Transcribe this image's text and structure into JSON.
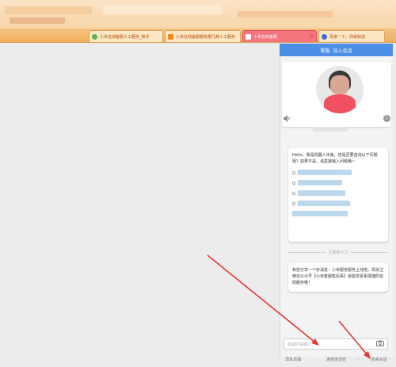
{
  "tabs": [
    {
      "title": "小米在线客服人工服务_知乎",
      "favicon_color": "#56b84a",
      "active": false
    },
    {
      "title": "小米在线客服都有哪几种人工服务",
      "favicon_color": "#f08a1c",
      "active": false
    },
    {
      "title": "小米在线客服",
      "favicon_color": "#ffffff",
      "active": true
    },
    {
      "title": "百度一下，你就知道",
      "favicon_color": "#3b6fd8",
      "active": false
    }
  ],
  "tab_close": "×",
  "panel": {
    "header_left": "客服",
    "header_right": "加入会话",
    "speaker_icon": "speaker-icon",
    "info_icon": "i"
  },
  "chat": {
    "greeting": "Hello，我是机器人米兔，您是否要咨询以下问题呢？如果不是，请直接输入问题哦~",
    "faq_marker": "Q",
    "faq_count": 5,
    "divider_label": "立即转人工",
    "notice": "和您分享一个好消息：小米服务服务上线啦，现关注微信公众号【小米客服售后事】就能享受更便捷的自助服务哦！"
  },
  "input": {
    "placeholder": "有疑问请输入",
    "camera_icon": "camera-icon"
  },
  "footer": {
    "links": [
      "隐私政策",
      "满意度调查",
      "结束会话"
    ]
  },
  "colors": {
    "accent": "#4d8fe6",
    "arrow": "#e53935",
    "tabbar": "#f2b15e"
  }
}
